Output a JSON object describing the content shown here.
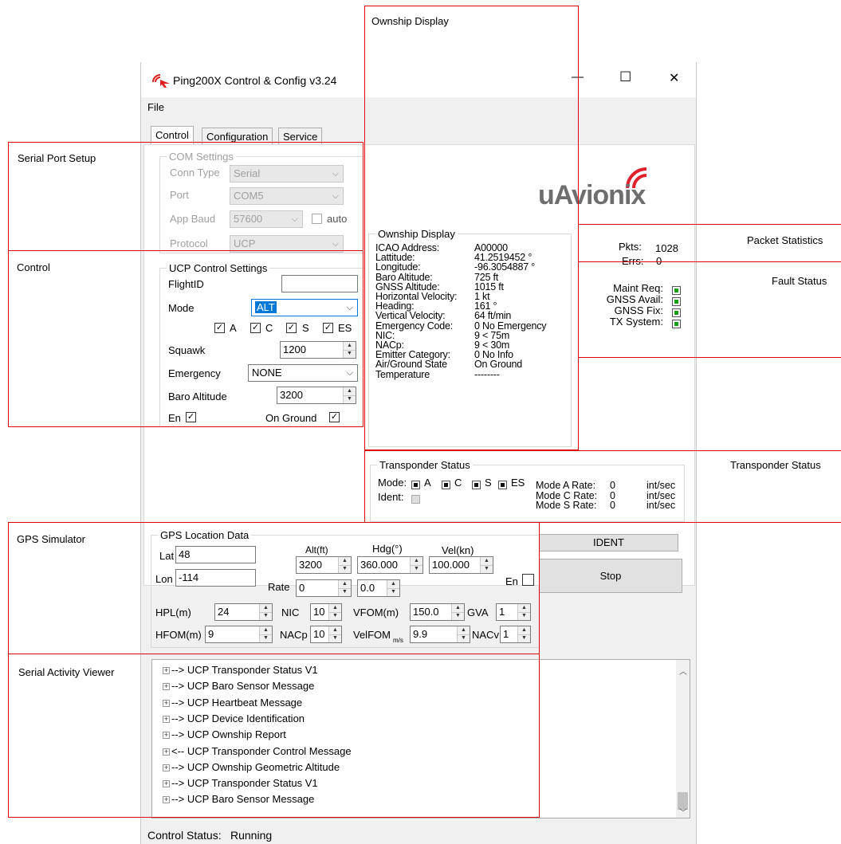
{
  "window": {
    "title": "Ping200X Control & Config v3.24",
    "controls": {
      "minimize": "—",
      "maximize": "☐",
      "close": "✕"
    }
  },
  "menu": {
    "file": "File"
  },
  "tabs": [
    "Control",
    "Configuration",
    "Service"
  ],
  "com_settings": {
    "legend": "COM Settings",
    "conn_type_label": "Conn Type",
    "conn_type": "Serial",
    "port_label": "Port",
    "port": "COM5",
    "app_baud_label": "App Baud",
    "app_baud": "57600",
    "auto_label": "auto",
    "protocol_label": "Protocol",
    "protocol": "UCP"
  },
  "ucp_control": {
    "legend": "UCP Control Settings",
    "flight_id_label": "FlightID",
    "flight_id": "",
    "mode_label": "Mode",
    "mode": "ALT",
    "checks": [
      "A",
      "C",
      "S",
      "ES"
    ],
    "squawk_label": "Squawk",
    "squawk": "1200",
    "emergency_label": "Emergency",
    "emergency": "NONE",
    "baro_label": "Baro Altitude",
    "baro": "3200",
    "en_label": "En",
    "on_ground_label": "On Ground"
  },
  "logo": "uAvionix",
  "ownship": {
    "legend": "Ownship Display",
    "rows": [
      [
        "ICAO Address:",
        "A00000"
      ],
      [
        "Lattitude:",
        "41.2519452 °"
      ],
      [
        "Longitude:",
        "-96.3054887 °"
      ],
      [
        "Baro Altitude:",
        "725 ft"
      ],
      [
        "GNSS Altitude:",
        "1015 ft"
      ],
      [
        "Horizontal Velocity:",
        "1 kt"
      ],
      [
        "Heading:",
        "161 °"
      ],
      [
        "Vertical Velocity:",
        "64 ft/min"
      ],
      [
        "Emergency Code:",
        "0   No Emergency"
      ],
      [
        "NIC:",
        "9   < 75m"
      ],
      [
        "NACp:",
        "9   < 30m"
      ],
      [
        "Emitter Category:",
        "0   No Info"
      ],
      [
        "Air/Ground State",
        "On Ground"
      ],
      [
        " Temperature",
        "--------"
      ]
    ]
  },
  "packets": {
    "pkts_label": "Pkts:",
    "pkts": "1028",
    "errs_label": "Errs:",
    "errs": "0"
  },
  "faults": [
    "Maint Req:",
    "GNSS Avail:",
    "GNSS Fix:",
    "TX System:"
  ],
  "transponder": {
    "legend": "Transponder Status",
    "mode_label": "Mode:",
    "modes": [
      "A",
      "C",
      "S",
      "ES"
    ],
    "ident_label": "Ident:",
    "rates": [
      {
        "label": "Mode A Rate:",
        "value": "0",
        "unit": "int/sec"
      },
      {
        "label": "Mode C Rate:",
        "value": "0",
        "unit": "int/sec"
      },
      {
        "label": "Mode S Rate:",
        "value": "0",
        "unit": "int/sec"
      }
    ]
  },
  "buttons": {
    "ident": "IDENT",
    "stop": "Stop"
  },
  "gps": {
    "legend": "GPS Location Data",
    "lat_label": "Lat",
    "lat": "48",
    "lon_label": "Lon",
    "lon": "-114",
    "alt_label": "Alt(ft)",
    "alt": "3200",
    "hdg_label": "Hdg(°)",
    "hdg": "360.000",
    "vel_label": "Vel(kn)",
    "vel": "100.000",
    "rate_label": "Rate",
    "rate_alt": "0",
    "rate_hdg": "0.0",
    "en_label": "En",
    "hpl_label": "HPL(m)",
    "hpl": "24",
    "nic_label": "NIC",
    "nic": "10",
    "vfom_label": "VFOM(m)",
    "vfom": "150.0",
    "gva_label": "GVA",
    "gva": "1",
    "hfom_label": "HFOM(m)",
    "hfom": "9",
    "nacp_label": "NACp",
    "nacp": "10",
    "velfom_label": "VelFOM",
    "velfom_sub": "m/s",
    "velfom": "9.9",
    "nacv_label": "NACv",
    "nacv": "1"
  },
  "serial_log": [
    "--> UCP Transponder Status V1",
    "--> UCP Baro Sensor Message",
    "--> UCP Heartbeat Message",
    "--> UCP Device Identification",
    "--> UCP Ownship Report",
    "<-- UCP Transponder Control Message",
    "--> UCP Ownship Geometric Altitude",
    "--> UCP Transponder Status V1",
    "--> UCP Baro Sensor Message"
  ],
  "status": {
    "label": "Control Status:",
    "value": "Running"
  },
  "annotations": {
    "ownship_display": "Ownship Display",
    "serial_port_setup": "Serial Port Setup",
    "control": "Control",
    "packet_statistics": "Packet Statistics",
    "fault_status": "Fault Status",
    "transponder_status": "Transponder Status",
    "gps_simulator": "GPS Simulator",
    "serial_activity_viewer": "Serial Activity Viewer"
  }
}
